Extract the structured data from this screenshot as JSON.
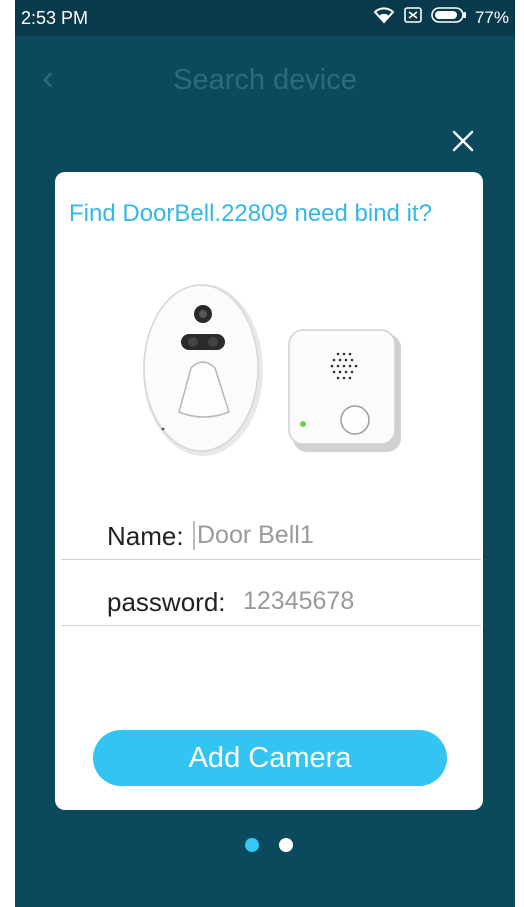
{
  "status_bar": {
    "time": "2:53 PM",
    "battery_percent": "77%",
    "icons": [
      "wifi-icon",
      "sim-disabled-icon",
      "battery-icon"
    ]
  },
  "header": {
    "title": "Search device",
    "back_icon": "chevron-left-icon"
  },
  "dialog": {
    "close_icon": "close-icon",
    "title": "Find DoorBell.22809 need bind it?",
    "image": "doorbell-camera-and-chime",
    "name_field": {
      "label": "Name:",
      "value": "Door Bell1"
    },
    "password_field": {
      "label": "password:",
      "value": "12345678"
    },
    "add_button": "Add Camera"
  },
  "pager": {
    "count": 2,
    "active_index": 0
  },
  "colors": {
    "background": "#0a4a5c",
    "accent": "#33c4f2",
    "title": "#35b7e6"
  }
}
